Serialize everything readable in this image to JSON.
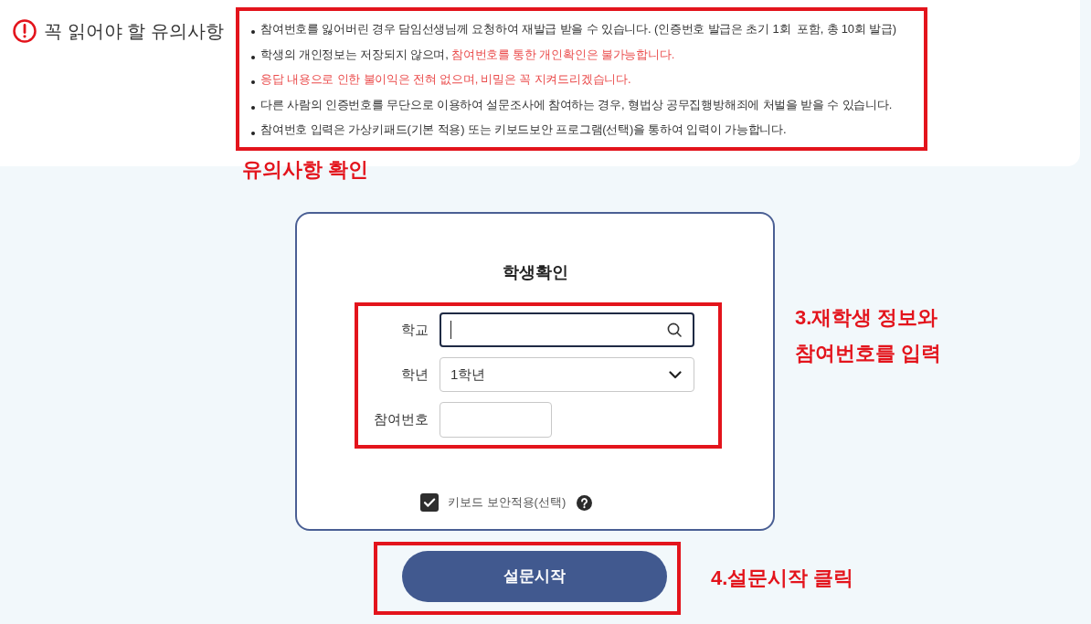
{
  "notice": {
    "title": "꼭 읽어야 할 유의사항",
    "items": [
      {
        "segments": [
          {
            "text": "참여번호를 잃어버린 경우 담임선생님께 요청하여 재발급 받을 수 있습니다. (인증번호 발급은 초기 1회  포함, 총 10회 발급)",
            "highlighted": false
          }
        ]
      },
      {
        "segments": [
          {
            "text": "학생의 개인정보는 저장되지 않으며, ",
            "highlighted": false
          },
          {
            "text": "참여번호를 통한 개인확인은 불가능합니다.",
            "highlighted": true
          }
        ]
      },
      {
        "segments": [
          {
            "text": "응답 내용으로 인한 불이익은 전혀 없으며, 비밀은 꼭 지켜드리겠습니다.",
            "highlighted": true
          }
        ]
      },
      {
        "segments": [
          {
            "text": "다른 사람의 인증번호를 무단으로 이용하여 설문조사에 참여하는 경우, 형법상 공무집행방해죄에 처벌을 받을 수 있습니다.",
            "highlighted": false
          }
        ]
      },
      {
        "segments": [
          {
            "text": "참여번호 입력은 가상키패드(기본 적용) 또는 키보드보안 프로그램(선택)을 통하여 입력이 가능합니다.",
            "highlighted": false
          }
        ]
      }
    ],
    "annotation": "유의사항 확인"
  },
  "form": {
    "title": "학생확인",
    "fields": [
      {
        "kind": "search",
        "label": "학교",
        "focused": true
      },
      {
        "kind": "select",
        "label": "학년",
        "value": "1학년",
        "focused": false
      },
      {
        "kind": "text",
        "label": "참여번호",
        "focused": false
      }
    ],
    "annotation_lines": [
      "3.재학생 정보와",
      "참여번호를 입력"
    ],
    "keyboard_security": {
      "label": "키보드 보안적용(선택)",
      "checked": true
    }
  },
  "start_button": {
    "label": "설문시작",
    "annotation": "4.설문시작 클릭"
  }
}
